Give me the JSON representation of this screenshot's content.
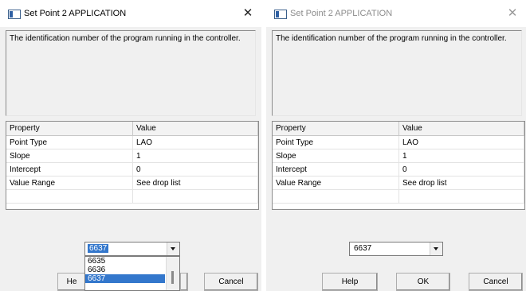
{
  "dialogs": [
    {
      "title": "Set Point 2  APPLICATION",
      "close_glyph": "✕",
      "description": "The identification number of the program running in the controller.",
      "grid": {
        "headers": [
          "Property",
          "Value"
        ],
        "rows": [
          [
            "Point Type",
            "LAO"
          ],
          [
            "Slope",
            "1"
          ],
          [
            "Intercept",
            "0"
          ],
          [
            "Value Range",
            "See drop list"
          ]
        ]
      },
      "combo": {
        "value": "6637",
        "open": true,
        "options": [
          "6635",
          "6636",
          "6637"
        ],
        "selected": "6637"
      },
      "buttons": {
        "help": "He",
        "cancel": "Cancel"
      }
    },
    {
      "title": "Set Point 2  APPLICATION",
      "close_glyph": "✕",
      "description": "The identification number of the program running in the controller.",
      "grid": {
        "headers": [
          "Property",
          "Value"
        ],
        "rows": [
          [
            "Point Type",
            "LAO"
          ],
          [
            "Slope",
            "1"
          ],
          [
            "Intercept",
            "0"
          ],
          [
            "Value Range",
            "See drop list"
          ]
        ]
      },
      "combo": {
        "value": "6637",
        "open": false
      },
      "buttons": {
        "help": "Help",
        "ok": "OK",
        "cancel": "Cancel"
      }
    }
  ],
  "icons": {
    "app": "application-window-icon",
    "close": "close-icon",
    "dropdown": "chevron-down-icon"
  },
  "colors": {
    "selection": "#3377cc",
    "dialog_bg": "#f0f0f0",
    "inactive_title": "#8c8c8c"
  }
}
